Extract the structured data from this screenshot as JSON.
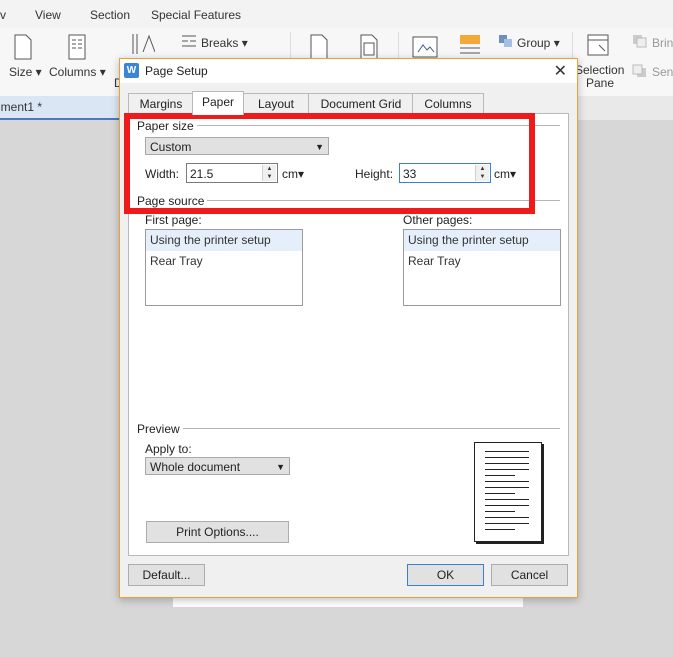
{
  "menubar": {
    "items": [
      "v",
      "View",
      "Section",
      "Special Features"
    ]
  },
  "ribbon": {
    "size_label": "Size",
    "columns_label": "Columns",
    "breaks_label": "Breaks",
    "group_label": "Group",
    "selection_pane_label_1": "Selection",
    "selection_pane_label_2": "Pane",
    "bring_label": "Brin",
    "send_label": "Send",
    "d_label": "D"
  },
  "document_tab": {
    "label": "ument1 *"
  },
  "dialog": {
    "title": "Page Setup",
    "tabs": [
      "Margins",
      "Paper",
      "Layout",
      "Document Grid",
      "Columns"
    ],
    "active_tab": "Paper",
    "paper_size": {
      "group_label": "Paper size",
      "selected": "Custom",
      "width_label": "Width:",
      "width_value": "21.5",
      "width_unit": "cm",
      "height_label": "Height:",
      "height_value": "33",
      "height_unit": "cm"
    },
    "page_source": {
      "group_label": "Page source",
      "first_page_label": "First page:",
      "first_page_items": [
        "Using the printer setup",
        "Rear Tray"
      ],
      "other_pages_label": "Other pages:",
      "other_pages_items": [
        "Using the printer setup",
        "Rear Tray"
      ]
    },
    "preview": {
      "group_label": "Preview",
      "apply_to_label": "Apply to:",
      "apply_to_value": "Whole document"
    },
    "buttons": {
      "print_options": "Print Options....",
      "default": "Default...",
      "ok": "OK",
      "cancel": "Cancel"
    }
  },
  "colors": {
    "highlight": "#ef1a1a",
    "dialog_border": "#e9a23b",
    "accent": "#3c7fd1"
  }
}
